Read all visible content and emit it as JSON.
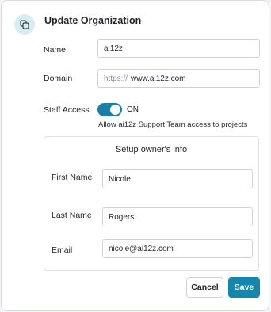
{
  "dialog": {
    "title": "Update Organization",
    "icon": "copy-icon"
  },
  "form": {
    "name": {
      "label": "Name",
      "value": "ai12z"
    },
    "domain": {
      "label": "Domain",
      "prefix": "https://",
      "value": "www.ai12z.com"
    },
    "staff_access": {
      "label": "Staff Access",
      "state": "ON",
      "enabled": true,
      "help": "Allow ai12z Support Team access to projects"
    }
  },
  "owner": {
    "title": "Setup owner's info",
    "first_name": {
      "label": "First Name",
      "value": "Nicole"
    },
    "last_name": {
      "label": "Last Name",
      "value": "Rogers"
    },
    "email": {
      "label": "Email",
      "value": "nicole@ai12z.com"
    }
  },
  "buttons": {
    "cancel": "Cancel",
    "save": "Save"
  },
  "colors": {
    "accent": "#1586ad",
    "toggle": "#1a7fa6",
    "icon_bg": "#d9eef4"
  }
}
